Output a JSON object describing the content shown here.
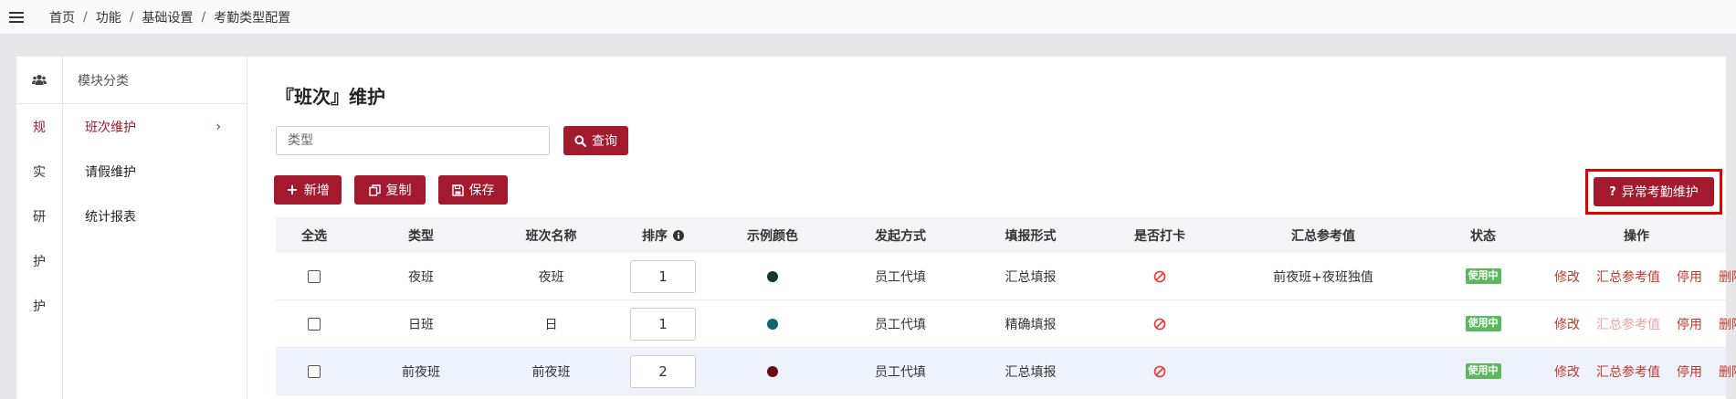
{
  "breadcrumb": [
    "首页",
    "功能",
    "基础设置",
    "考勤类型配置"
  ],
  "rail": {
    "items": [
      "规",
      "实",
      "研",
      "护",
      "护"
    ]
  },
  "subnav": {
    "header": "模块分类",
    "items": [
      {
        "label": "班次维护",
        "active": true,
        "arrow": "›"
      },
      {
        "label": "请假维护"
      },
      {
        "label": "统计报表"
      }
    ]
  },
  "page": {
    "title": "『班次』维护"
  },
  "search": {
    "placeholder": "类型",
    "query_label": "查询"
  },
  "toolbar": {
    "add": "新增",
    "copy": "复制",
    "save": "保存",
    "abnormal": "异常考勤维护"
  },
  "table": {
    "headers": [
      "全选",
      "类型",
      "班次名称",
      "排序",
      "示例颜色",
      "发起方式",
      "填报形式",
      "是否打卡",
      "汇总参考值",
      "状态",
      "操作"
    ],
    "rows": [
      {
        "type": "夜班",
        "name": "夜班",
        "order": "1",
        "color": "#0f3d1f",
        "initiate": "员工代填",
        "fill": "汇总填报",
        "summary": "前夜班+夜班独值",
        "status": "使用中",
        "ops": [
          "修改",
          "汇总参考值",
          "停用",
          "删除"
        ]
      },
      {
        "type": "日班",
        "name": "日",
        "order": "1",
        "color": "#0f6670",
        "initiate": "员工代填",
        "fill": "精确填报",
        "summary": "",
        "status": "使用中",
        "ops": [
          "修改",
          "汇总参考值",
          "停用",
          "删除"
        ]
      },
      {
        "type": "前夜班",
        "name": "前夜班",
        "order": "2",
        "color": "#6b0a14",
        "initiate": "员工代填",
        "fill": "汇总填报",
        "summary": "",
        "status": "使用中",
        "ops": [
          "修改",
          "汇总参考值",
          "停用",
          "删除"
        ]
      }
    ]
  },
  "colors": {
    "accent": "#a3192e",
    "link": "#c0392b",
    "badge": "#5cb85c",
    "highlight": "#e00000"
  }
}
